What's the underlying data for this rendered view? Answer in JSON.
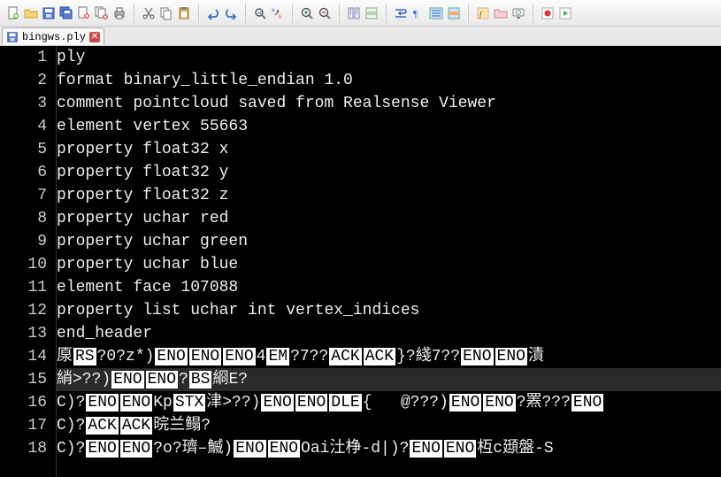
{
  "tabs": [
    {
      "filename": "bingws.ply"
    }
  ],
  "editor": {
    "caret_line": 15,
    "lines": [
      {
        "n": 1,
        "text": "ply"
      },
      {
        "n": 2,
        "text": "format binary_little_endian 1.0"
      },
      {
        "n": 3,
        "text": "comment pointcloud saved from Realsense Viewer"
      },
      {
        "n": 4,
        "text": "element vertex 55663"
      },
      {
        "n": 5,
        "text": "property float32 x"
      },
      {
        "n": 6,
        "text": "property float32 y"
      },
      {
        "n": 7,
        "text": "property float32 z"
      },
      {
        "n": 8,
        "text": "property uchar red"
      },
      {
        "n": 9,
        "text": "property uchar green"
      },
      {
        "n": 10,
        "text": "property uchar blue"
      },
      {
        "n": 11,
        "text": "element face 107088"
      },
      {
        "n": 12,
        "text": "property list uchar int vertex_indices"
      },
      {
        "n": 13,
        "text": "end_header"
      },
      {
        "n": 14,
        "segments": [
          {
            "t": "厡"
          },
          {
            "c": "RS"
          },
          {
            "t": "?0?z*)"
          },
          {
            "c": "ENO"
          },
          {
            "c": "ENO"
          },
          {
            "c": "ENO"
          },
          {
            "t": "4"
          },
          {
            "c": "EM"
          },
          {
            "t": "?7??"
          },
          {
            "c": "ACK"
          },
          {
            "c": "ACK"
          },
          {
            "t": "}?綫7??"
          },
          {
            "c": "ENO"
          },
          {
            "c": "ENO"
          },
          {
            "t": "漬"
          }
        ]
      },
      {
        "n": 15,
        "segments": [
          {
            "t": "綃>??)"
          },
          {
            "c": "ENO"
          },
          {
            "c": "ENO"
          },
          {
            "t": "?"
          },
          {
            "c": "BS"
          },
          {
            "t": "綗E?"
          }
        ]
      },
      {
        "n": 16,
        "segments": [
          {
            "t": "C)?"
          },
          {
            "c": "ENO"
          },
          {
            "c": "ENO"
          },
          {
            "t": "Kp"
          },
          {
            "c": "STX"
          },
          {
            "t": "津>??)"
          },
          {
            "c": "ENO"
          },
          {
            "c": "ENO"
          },
          {
            "c": "DLE"
          },
          {
            "t": "{   @???)"
          },
          {
            "c": "ENO"
          },
          {
            "c": "ENO"
          },
          {
            "t": "?罴???"
          },
          {
            "c": "ENO"
          }
        ]
      },
      {
        "n": 17,
        "segments": [
          {
            "t": "C)?"
          },
          {
            "c": "ACK"
          },
          {
            "c": "ACK"
          },
          {
            "t": "晥兰鳎?"
          }
        ]
      },
      {
        "n": 18,
        "segments": [
          {
            "t": "C)?"
          },
          {
            "c": "ENO"
          },
          {
            "c": "ENO"
          },
          {
            "t": "?o?璾–鰄)"
          },
          {
            "c": "ENO"
          },
          {
            "c": "ENO"
          },
          {
            "t": "Oai汢棦-d|)?"
          },
          {
            "c": "ENO"
          },
          {
            "c": "ENO"
          },
          {
            "t": "枑c頲盤-S"
          }
        ]
      }
    ]
  },
  "toolbar_icons": [
    [
      "new-file",
      "open-file",
      "save",
      "save-all",
      "close",
      "close-all",
      "print"
    ],
    [
      "cut",
      "copy",
      "paste"
    ],
    [
      "undo",
      "redo"
    ],
    [
      "find",
      "replace"
    ],
    [
      "zoom-in",
      "zoom-out"
    ],
    [
      "sync-v",
      "sync-h"
    ],
    [
      "wrap",
      "show-all",
      "indent-guide",
      "highlight"
    ],
    [
      "folder-user",
      "bookmark"
    ],
    [
      "preview",
      "visibility"
    ],
    [
      "record",
      "play"
    ]
  ]
}
